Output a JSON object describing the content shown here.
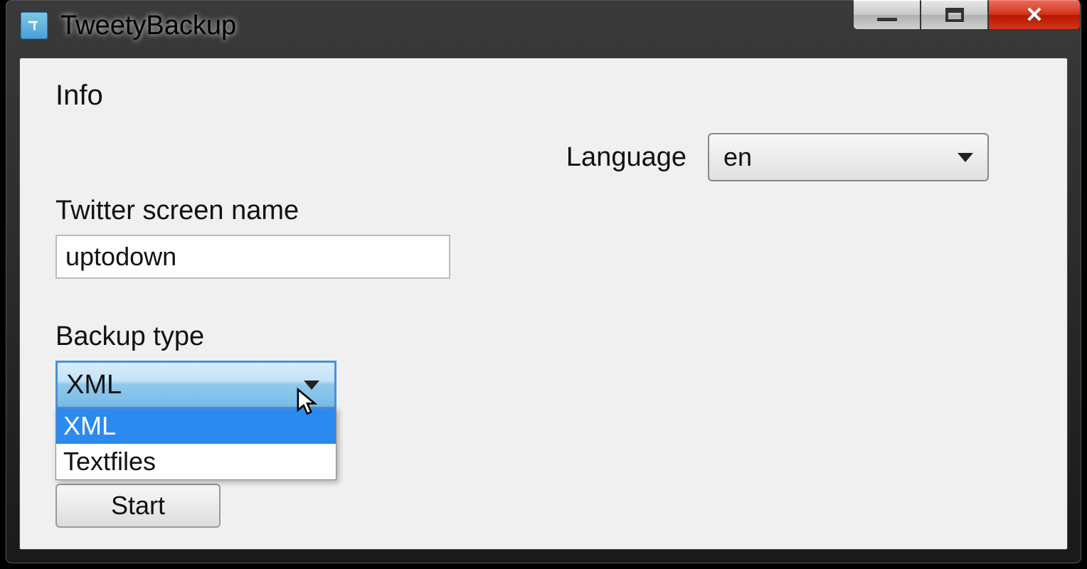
{
  "window": {
    "title": "TweetyBackup"
  },
  "info": {
    "heading": "Info"
  },
  "language": {
    "label": "Language",
    "selected": "en"
  },
  "screenName": {
    "label": "Twitter screen name",
    "value": "uptodown"
  },
  "backupType": {
    "label": "Backup type",
    "selected": "XML",
    "options": [
      "XML",
      "Textfiles"
    ]
  },
  "buttons": {
    "start": "Start"
  }
}
